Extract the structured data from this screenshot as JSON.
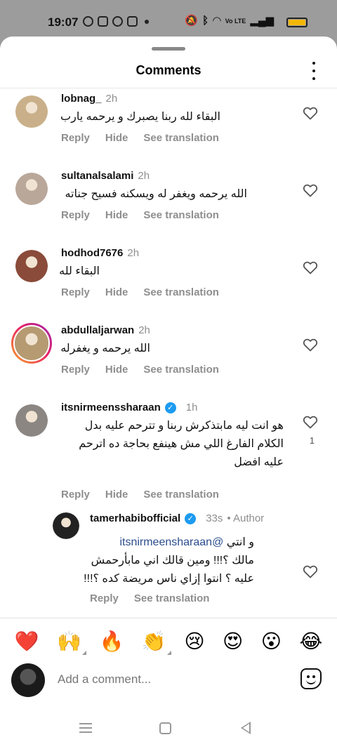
{
  "status_bar": {
    "time": "19:07",
    "left_icons": [
      "whatsapp-icon",
      "whatsapp-business-icon",
      "missed-call-icon",
      "instagram-icon",
      "notification-dot-icon"
    ],
    "right_icons": [
      "mute-icon",
      "bluetooth-icon",
      "wifi-icon",
      "volte-icon",
      "signal-icon",
      "battery-icon"
    ],
    "volte_label": "Vo LTE",
    "battery_color": "#f2b705"
  },
  "sheet": {
    "title": "Comments",
    "more_icon": "more-vertical-icon"
  },
  "actions": {
    "reply": "Reply",
    "hide": "Hide",
    "see_translation": "See translation"
  },
  "comments": [
    {
      "username": "lobnag_",
      "time": "2h",
      "text": "البقاء لله ربنا يصبرك و يرحمه يارب",
      "avatar_color": "#c9b08a"
    },
    {
      "username": "sultanalsalami",
      "time": "2h",
      "text": "الله يرحمه ويغفر له ويسكنه فسيح جناته",
      "avatar_color": "#b9a79a"
    },
    {
      "username": "hodhod7676",
      "time": "2h",
      "text": "البقاء لله",
      "avatar_color": "#8a4b3a"
    },
    {
      "username": "abdullaljarwan",
      "time": "2h",
      "text": "الله يرحمه و يغفرله",
      "avatar_color": "#b59a72"
    },
    {
      "username": "itsnirmeenssharaan",
      "verified": true,
      "time": "1h",
      "lines": [
        "هو انت ليه مابتذكرش ربنا و تترحم عليه بدل",
        "الكلام الفارغ اللي مش هينفع بحاجة ده اترحم",
        "عليه افضل"
      ],
      "likes": "1",
      "avatar_color": "#8b8682"
    }
  ],
  "reply": {
    "username": "tamerhabibofficial",
    "verified": true,
    "time": "33s",
    "author_label": "• Author",
    "mention": "@itsnirmeensharaan",
    "line1_suffix": "و انتي",
    "line2": "مالك ؟!!! ومين قالك اني مابأرحمش",
    "line3": "عليه ؟ انتوا إزاي ناس مريضة كده ؟!!!",
    "avatar_color": "#222222"
  },
  "emojis": [
    {
      "char": "❤️",
      "name": "red-heart-emoji",
      "variants": false
    },
    {
      "char": "🙌",
      "name": "raising-hands-emoji",
      "variants": true
    },
    {
      "char": "🔥",
      "name": "fire-emoji",
      "variants": false
    },
    {
      "char": "👏",
      "name": "clapping-hands-emoji",
      "variants": true
    },
    {
      "char": "😢",
      "name": "crying-face-emoji",
      "variants": false
    },
    {
      "char": "😍",
      "name": "heart-eyes-emoji",
      "variants": false
    },
    {
      "char": "😮",
      "name": "surprised-face-emoji",
      "variants": false
    },
    {
      "char": "😂",
      "name": "tears-of-joy-emoji",
      "variants": false
    }
  ],
  "composer": {
    "placeholder": "Add a comment...",
    "sticker_icon": "sticker-icon"
  },
  "nav": {
    "icons": [
      "menu-icon",
      "home-icon",
      "back-icon"
    ]
  }
}
